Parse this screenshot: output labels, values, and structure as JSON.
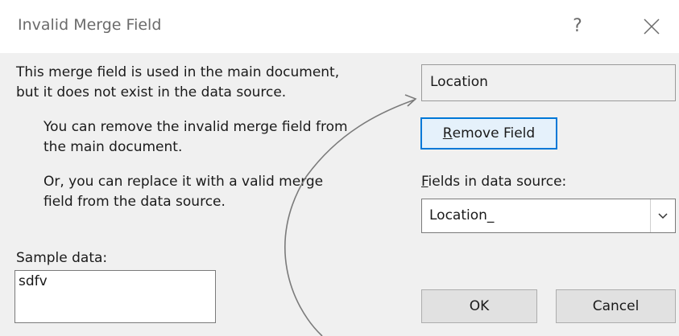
{
  "window": {
    "title": "Invalid Merge Field",
    "help_label": "?"
  },
  "messages": {
    "line1": "This merge field is used in the main document,",
    "line2": "but it does not exist in the data source.",
    "remove_line1": "You can remove the invalid merge field from",
    "remove_line2": "the main document.",
    "replace_line1": "Or, you can replace it with a valid merge",
    "replace_line2": "field from the data source."
  },
  "invalid_field": {
    "value": "Location"
  },
  "buttons": {
    "remove_hotkey": "R",
    "remove_rest": "emove Field",
    "ok": "OK",
    "cancel": "Cancel"
  },
  "fields_in_data_source": {
    "label_hotkey": "F",
    "label_rest": "ields in data source:",
    "selected": "Location_"
  },
  "sample": {
    "label": "Sample data:",
    "value": "sdfv"
  },
  "icons": {
    "close": "close-icon",
    "dropdown": "chevron-down-icon"
  },
  "colors": {
    "focus_border": "#0078d7",
    "dialog_bg": "#f0f0f0"
  }
}
